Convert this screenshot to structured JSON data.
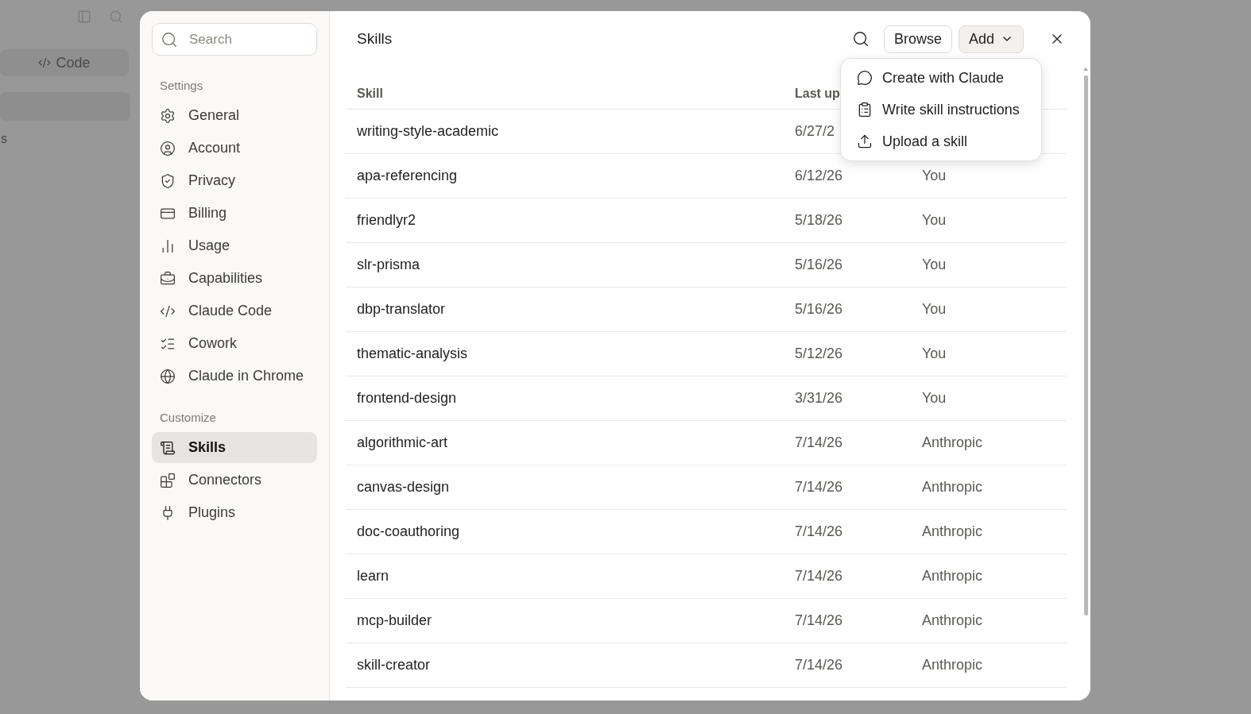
{
  "background": {
    "code_button": "Code",
    "fragment": "s"
  },
  "sidebar": {
    "search": {
      "placeholder": "Search"
    },
    "sections": [
      {
        "title": "Settings",
        "items": [
          {
            "label": "General",
            "selected": false
          },
          {
            "label": "Account",
            "selected": false
          },
          {
            "label": "Privacy",
            "selected": false
          },
          {
            "label": "Billing",
            "selected": false
          },
          {
            "label": "Usage",
            "selected": false
          },
          {
            "label": "Capabilities",
            "selected": false
          },
          {
            "label": "Claude Code",
            "selected": false
          },
          {
            "label": "Cowork",
            "selected": false
          },
          {
            "label": "Claude in Chrome",
            "selected": false
          }
        ]
      },
      {
        "title": "Customize",
        "items": [
          {
            "label": "Skills",
            "selected": true
          },
          {
            "label": "Connectors",
            "selected": false
          },
          {
            "label": "Plugins",
            "selected": false
          }
        ]
      }
    ]
  },
  "main": {
    "title": "Skills",
    "buttons": [
      {
        "label": "Browse",
        "kind": "plain"
      },
      {
        "label": "Add",
        "kind": "dropdown",
        "expanded": true
      }
    ],
    "menu": [
      {
        "label": "Create with Claude"
      },
      {
        "label": "Write skill instructions"
      },
      {
        "label": "Upload a skill"
      }
    ],
    "table": {
      "columns": [
        "Skill",
        "Last up"
      ],
      "rows": [
        {
          "name": "writing-style-academic",
          "updated": "6/27/2"
        },
        {
          "name": "apa-referencing",
          "updated": "6/12/26",
          "author": "You"
        },
        {
          "name": "friendlyr2",
          "updated": "5/18/26",
          "author": "You"
        },
        {
          "name": "slr-prisma",
          "updated": "5/16/26",
          "author": "You"
        },
        {
          "name": "dbp-translator",
          "updated": "5/16/26",
          "author": "You"
        },
        {
          "name": "thematic-analysis",
          "updated": "5/12/26",
          "author": "You"
        },
        {
          "name": "frontend-design",
          "updated": "3/31/26",
          "author": "You"
        },
        {
          "name": "algorithmic-art",
          "updated": "7/14/26",
          "author": "Anthropic"
        },
        {
          "name": "canvas-design",
          "updated": "7/14/26",
          "author": "Anthropic"
        },
        {
          "name": "doc-coauthoring",
          "updated": "7/14/26",
          "author": "Anthropic"
        },
        {
          "name": "learn",
          "updated": "7/14/26",
          "author": "Anthropic"
        },
        {
          "name": "mcp-builder",
          "updated": "7/14/26",
          "author": "Anthropic"
        },
        {
          "name": "skill-creator",
          "updated": "7/14/26",
          "author": "Anthropic"
        }
      ]
    }
  }
}
